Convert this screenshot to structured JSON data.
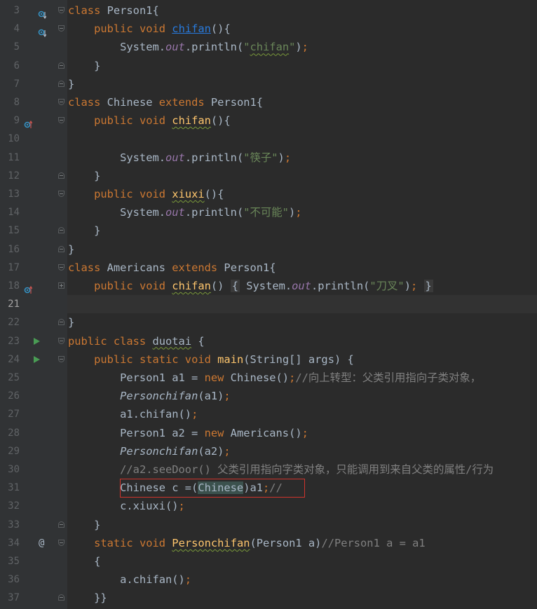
{
  "editor": {
    "lines": [
      {
        "n": "3",
        "html": "<span class='kw'>class</span> Person1{"
      },
      {
        "n": "4",
        "html": "    <span class='kw'>public void</span> <span class='link'>chifan</span>(){"
      },
      {
        "n": "5",
        "html": "        System.<span class='fld'>out</span>.println(<span class='str'>\"<span class='sq'>chifan</span>\"</span>)<span class='kw'>;</span>"
      },
      {
        "n": "6",
        "html": "    }"
      },
      {
        "n": "7",
        "html": "}"
      },
      {
        "n": "8",
        "html": "<span class='kw'>class</span> Chinese <span class='kw'>extends</span> Person1{"
      },
      {
        "n": "9",
        "html": "    <span class='kw'>public void</span> <span class='fn sq'>chifan</span>(){"
      },
      {
        "n": "10",
        "html": ""
      },
      {
        "n": "11",
        "html": "        System.<span class='fld'>out</span>.println(<span class='str'>\"筷子\"</span>)<span class='kw'>;</span>"
      },
      {
        "n": "12",
        "html": "    }"
      },
      {
        "n": "13",
        "html": "    <span class='kw'>public void</span> <span class='fn sq'>xiuxi</span>(){"
      },
      {
        "n": "14",
        "html": "        System.<span class='fld'>out</span>.println(<span class='str'>\"不可能\"</span>)<span class='kw'>;</span>"
      },
      {
        "n": "15",
        "html": "    }"
      },
      {
        "n": "16",
        "html": "}"
      },
      {
        "n": "17",
        "html": "<span class='kw'>class</span> Americans <span class='kw'>extends</span> Person1{"
      },
      {
        "n": "18",
        "html": "    <span class='kw'>public void</span> <span class='fn sq'>chifan</span>() <span class='foldbox'>{</span> System.<span class='fld'>out</span>.println(<span class='str'>\"刀叉\"</span>)<span class='kw'>;</span> <span class='foldbox'>}</span>"
      },
      {
        "n": "21",
        "html": "",
        "current": true
      },
      {
        "n": "22",
        "html": "}"
      },
      {
        "n": "23",
        "html": "<span class='kw'>public class</span> <span class='sq'>duotai</span> {"
      },
      {
        "n": "24",
        "html": "    <span class='kw'>public static void</span> <span class='fn'>main</span>(String[] args) {"
      },
      {
        "n": "25",
        "html": "        Person1 a1 = <span class='kw'>new</span> Chinese()<span class='kw'>;</span><span class='cmt'>//向上转型：父类引用指向子类对象，</span>"
      },
      {
        "n": "26",
        "html": "        <span class='ital'>Personchifan</span>(a1)<span class='kw'>;</span>"
      },
      {
        "n": "27",
        "html": "        a1.chifan()<span class='kw'>;</span>"
      },
      {
        "n": "28",
        "html": "        Person1 a2 = <span class='kw'>new</span> Americans()<span class='kw'>;</span>"
      },
      {
        "n": "29",
        "html": "        <span class='ital'>Personchifan</span>(a2)<span class='kw'>;</span>"
      },
      {
        "n": "30",
        "html": "        <span class='cmt'>//a2.seeDoor() 父类引用指向字类对象，只能调用到来自父类的属性/行为</span>"
      },
      {
        "n": "31",
        "html": "        Chinese c =(<span class='hl'>Chinese</span>)a1<span class='kw'>;</span><span class='cmt'>//</span>"
      },
      {
        "n": "32",
        "html": "        c.xiuxi()<span class='kw'>;</span>"
      },
      {
        "n": "33",
        "html": "    }"
      },
      {
        "n": "34",
        "html": "    <span class='kw'>static void</span> <span class='fn sq'>Personchifan</span>(Person1 a)<span class='cmt'>//Person1 a = a1</span>"
      },
      {
        "n": "35",
        "html": "    {"
      },
      {
        "n": "36",
        "html": "        a.chifan()<span class='kw'>;</span>"
      },
      {
        "n": "37",
        "html": "    }}"
      }
    ],
    "gutter": {
      "3": [
        "ovr-down",
        "fold-open"
      ],
      "4": [
        "ovr-down",
        "fold-open"
      ],
      "6": [
        "fold-close"
      ],
      "7": [
        "fold-close"
      ],
      "8": [
        "fold-open"
      ],
      "9": [
        "ovr-up",
        "fold-open"
      ],
      "12": [
        "fold-close"
      ],
      "13": [
        "fold-open"
      ],
      "15": [
        "fold-close"
      ],
      "16": [
        "fold-close"
      ],
      "17": [
        "fold-open"
      ],
      "18": [
        "ovr-up",
        "fold-plus"
      ],
      "22": [
        "fold-close"
      ],
      "23": [
        "run",
        "fold-open"
      ],
      "24": [
        "run",
        "fold-open"
      ],
      "33": [
        "fold-close"
      ],
      "34": [
        "at",
        "fold-open"
      ],
      "37": [
        "fold-close"
      ]
    }
  }
}
